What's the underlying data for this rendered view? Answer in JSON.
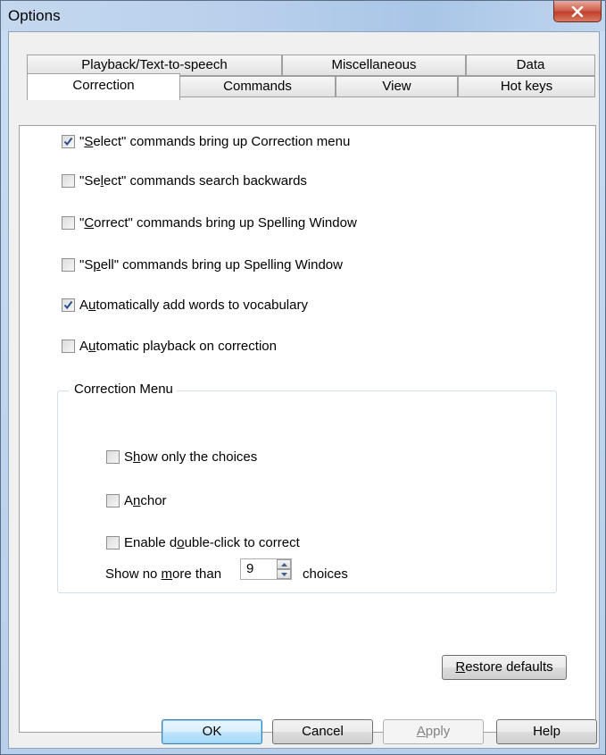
{
  "window": {
    "title": "Options"
  },
  "tabs_back": [
    {
      "label": "Playback/Text-to-speech"
    },
    {
      "label": "Miscellaneous"
    },
    {
      "label": "Data"
    }
  ],
  "tabs_front": [
    {
      "label": "Correction",
      "active": true
    },
    {
      "label": "Commands"
    },
    {
      "label": "View"
    },
    {
      "label": "Hot keys"
    }
  ],
  "options": [
    {
      "pre": "\"",
      "u": "S",
      "post": "elect\" commands bring up Correction menu",
      "checked": true
    },
    {
      "pre": "\"Se",
      "u": "l",
      "post": "ect\" commands search backwards",
      "checked": false
    },
    {
      "pre": "\"",
      "u": "C",
      "post": "orrect\" commands bring up Spelling Window",
      "checked": false
    },
    {
      "pre": "\"S",
      "u": "p",
      "post": "ell\" commands bring up Spelling Window",
      "checked": false
    },
    {
      "pre": "A",
      "u": "u",
      "post": "tomatically add words to vocabulary",
      "checked": true
    },
    {
      "pre": "A",
      "u": "u",
      "post": "tomatic playback on correction",
      "checked": false
    }
  ],
  "correction_menu": {
    "title": "Correction Menu",
    "items": [
      {
        "pre": "S",
        "u": "h",
        "post": "ow only the choices",
        "checked": false
      },
      {
        "pre": "A",
        "u": "n",
        "post": "chor",
        "checked": false
      },
      {
        "pre": "Enable d",
        "u": "o",
        "post": "uble-click to correct",
        "checked": false
      }
    ],
    "limit_pre": "Show no ",
    "limit_u": "m",
    "limit_post": "ore than",
    "limit_value": "9",
    "limit_suffix": "choices"
  },
  "restore": {
    "u": "R",
    "post": "estore defaults"
  },
  "buttons": {
    "ok": "OK",
    "cancel": "Cancel",
    "apply_u": "A",
    "apply_post": "pply",
    "help": "Help"
  }
}
